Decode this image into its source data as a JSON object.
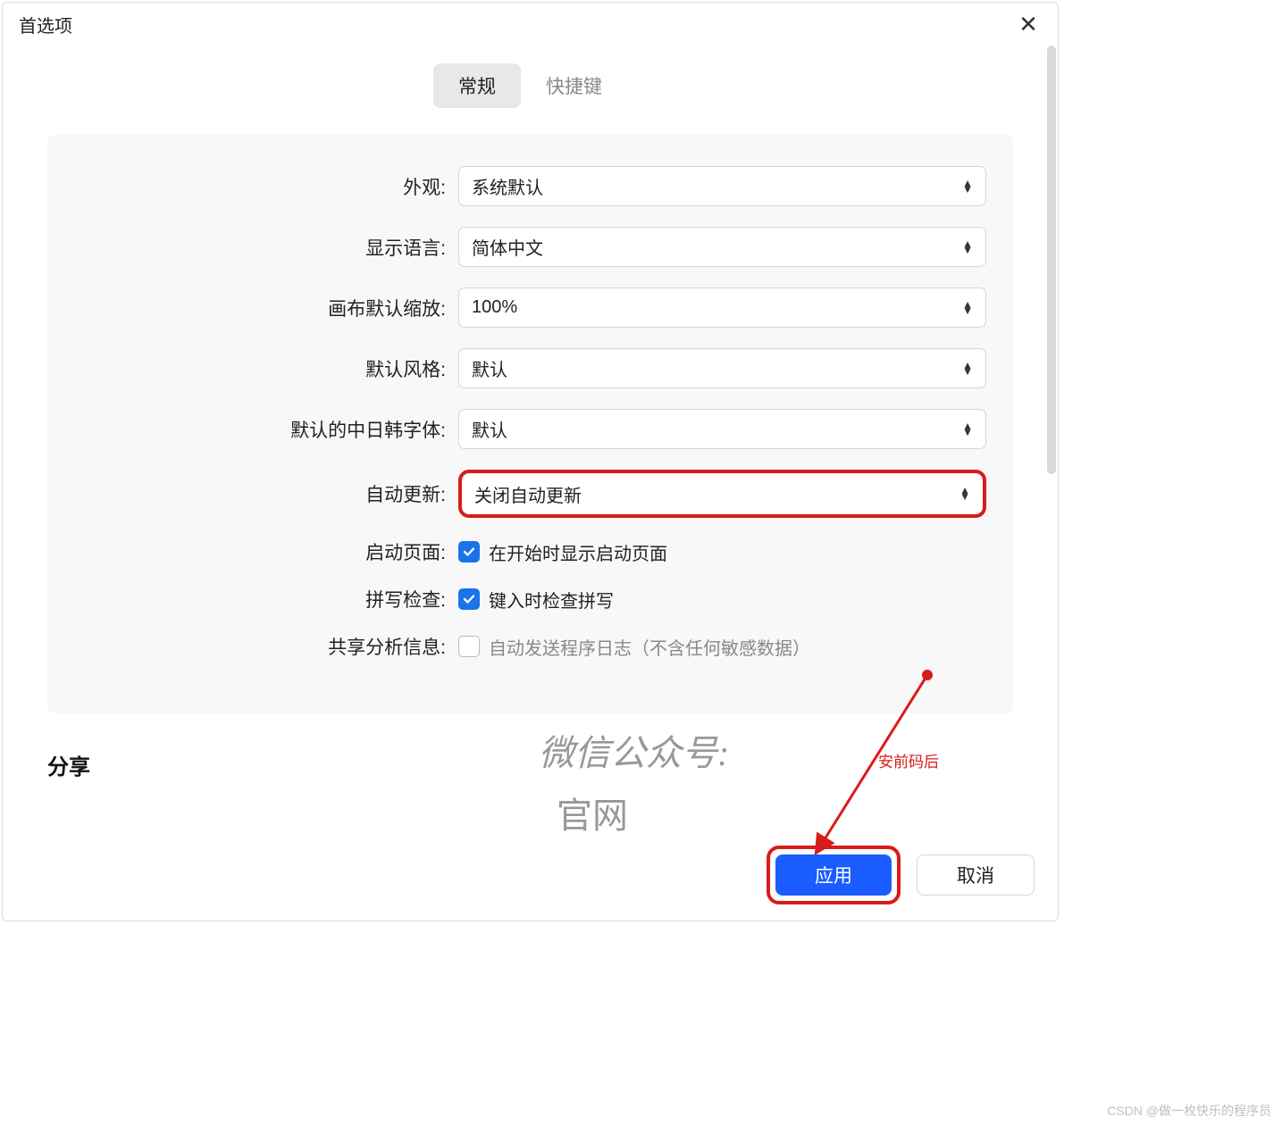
{
  "window": {
    "title": "首选项"
  },
  "tabs": {
    "general": "常规",
    "shortcuts": "快捷键"
  },
  "form": {
    "appearance": {
      "label": "外观:",
      "value": "系统默认"
    },
    "language": {
      "label": "显示语言:",
      "value": "简体中文"
    },
    "zoom": {
      "label": "画布默认缩放:",
      "value": "100%"
    },
    "style": {
      "label": "默认风格:",
      "value": "默认"
    },
    "cjkfont": {
      "label": "默认的中日韩字体:",
      "value": "默认"
    },
    "autoupdate": {
      "label": "自动更新:",
      "value": "关闭自动更新"
    },
    "startpage": {
      "label": "启动页面:",
      "checkbox_label": "在开始时显示启动页面"
    },
    "spellcheck": {
      "label": "拼写检查:",
      "checkbox_label": "键入时检查拼写"
    },
    "analytics": {
      "label": "共享分析信息:",
      "checkbox_label": "自动发送程序日志（不含任何敏感数据）"
    }
  },
  "section": {
    "share": "分享"
  },
  "footer": {
    "apply": "应用",
    "cancel": "取消"
  },
  "annotation": {
    "label": "安前码后"
  },
  "watermark": {
    "line1": "微信公众号:",
    "line2": "官网"
  },
  "credit": "CSDN @做一枚快乐的程序员"
}
